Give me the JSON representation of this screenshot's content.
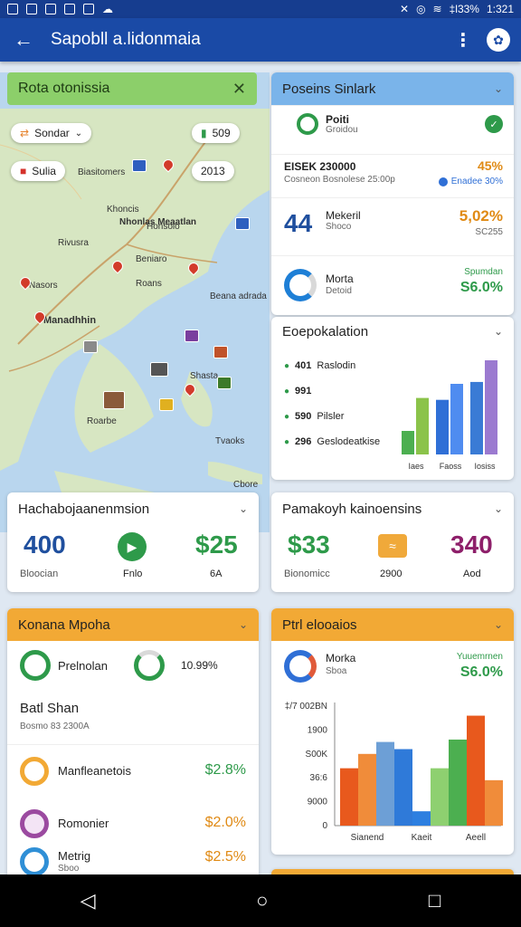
{
  "status": {
    "battery": "‡l33%",
    "time": "1:321"
  },
  "app": {
    "title": "Sapobll a.lidonmaia"
  },
  "map": {
    "header": "Rota otonissia",
    "chip_sender": "Sondar",
    "chip_right_top": "509",
    "chip_left": "Sulia",
    "label_2012": "2013",
    "labels": [
      "Biasitomers",
      "Khoncis",
      "Honsolo",
      "Rivusra",
      "Nhonlas Meaatlan",
      "Beniaro",
      "Nasors",
      "Roans",
      "Manadhhin",
      "Beana adrada",
      "Roarbe",
      "Shasta",
      "Tvaoks",
      "Cbore"
    ]
  },
  "stats": {
    "header": "Poseins Sinlark",
    "item1_title": "Poiti",
    "item1_sub": "Groidou",
    "item2_label": "EISEK 230000",
    "item2_sub": "Cosneon Bosnolese 25:00p",
    "item2_value": "45%",
    "item2_badge": "Enadee 30%",
    "item3_big": "44",
    "item3_title": "Mekeril",
    "item3_sub": "Shoco",
    "item3_value": "5,02%",
    "item3_small": "SC255",
    "item4_title": "Morta",
    "item4_sub": "Detoid",
    "item4_label": "Spumdan",
    "item4_value": "S6.0%"
  },
  "region": {
    "header": "Eoepokalation",
    "items": [
      {
        "value": "401",
        "label": "Raslodin"
      },
      {
        "value": "991",
        "label": ""
      },
      {
        "value": "590",
        "label": "Pilsler"
      },
      {
        "value": "296",
        "label": "Geslodeatkise"
      }
    ],
    "bar_labels": [
      "Iaes",
      "Faoss",
      "Iosiss"
    ]
  },
  "chart_data": [
    {
      "type": "bar",
      "categories": [
        "Iaes",
        "Faoss",
        "Iosiss"
      ],
      "series": [
        {
          "values": [
            25,
            60
          ]
        },
        {
          "values": [
            58,
            75
          ]
        },
        {
          "values": [
            77,
            100
          ]
        }
      ],
      "colors": [
        "#4caf50",
        "#8bc34a",
        "#2f6fd6",
        "#4f8cf0",
        "#3a7bd5",
        "#9b7ad0"
      ]
    },
    {
      "type": "bar",
      "xlabel": "",
      "ylabel": "",
      "y_tick_labels": [
        "‡/7 002BN",
        "1900",
        "S00K",
        "36:6",
        "9000",
        "0"
      ],
      "categories": [
        "Sianend",
        "Kaeit",
        "Aeell"
      ],
      "series": [
        {
          "values": [
            48,
            64,
            72
          ]
        },
        {
          "values": [
            60,
            12,
            92
          ]
        },
        {
          "values": [
            70,
            48,
            38
          ]
        }
      ],
      "colors": [
        "#e8591d",
        "#f08c3a",
        "#6d9fd6",
        "#2f7ad9",
        "#2d7fe0",
        "#8ed070",
        "#4caf50"
      ]
    }
  ],
  "p1": {
    "header": "Hachabojaanenmsion",
    "v1": "400",
    "l1": "Bloocian",
    "l2": "Fnlo",
    "v3": "$25",
    "l3": "6A"
  },
  "p2": {
    "header": "Pamakoyh kainoensins",
    "v1": "$33",
    "l1": "Bionomicc",
    "l2": "2900",
    "v3": "340",
    "l3": "Aod"
  },
  "k": {
    "header": "Konana Mpoha",
    "row1_title": "Prelnolan",
    "row1_value": "10.99%",
    "row2_title": "Batl Shan",
    "row2_sub": "Bosmo 83 2300A",
    "row3_title": "Manfleanetois",
    "row3_value": "$2.8%",
    "row4_title": "Romonier",
    "row4_value": "$2.0%",
    "row5_title": "Metrig",
    "row5_sub": "Sboo",
    "row5_value": "$2.5%"
  },
  "pt": {
    "header": "Ptrl elooaios",
    "title": "Morka",
    "sub": "Sboa",
    "label": "Yuuemrnen",
    "value": "S6.0%"
  },
  "nav": {
    "back": "◁",
    "home": "○",
    "recents": "□"
  }
}
